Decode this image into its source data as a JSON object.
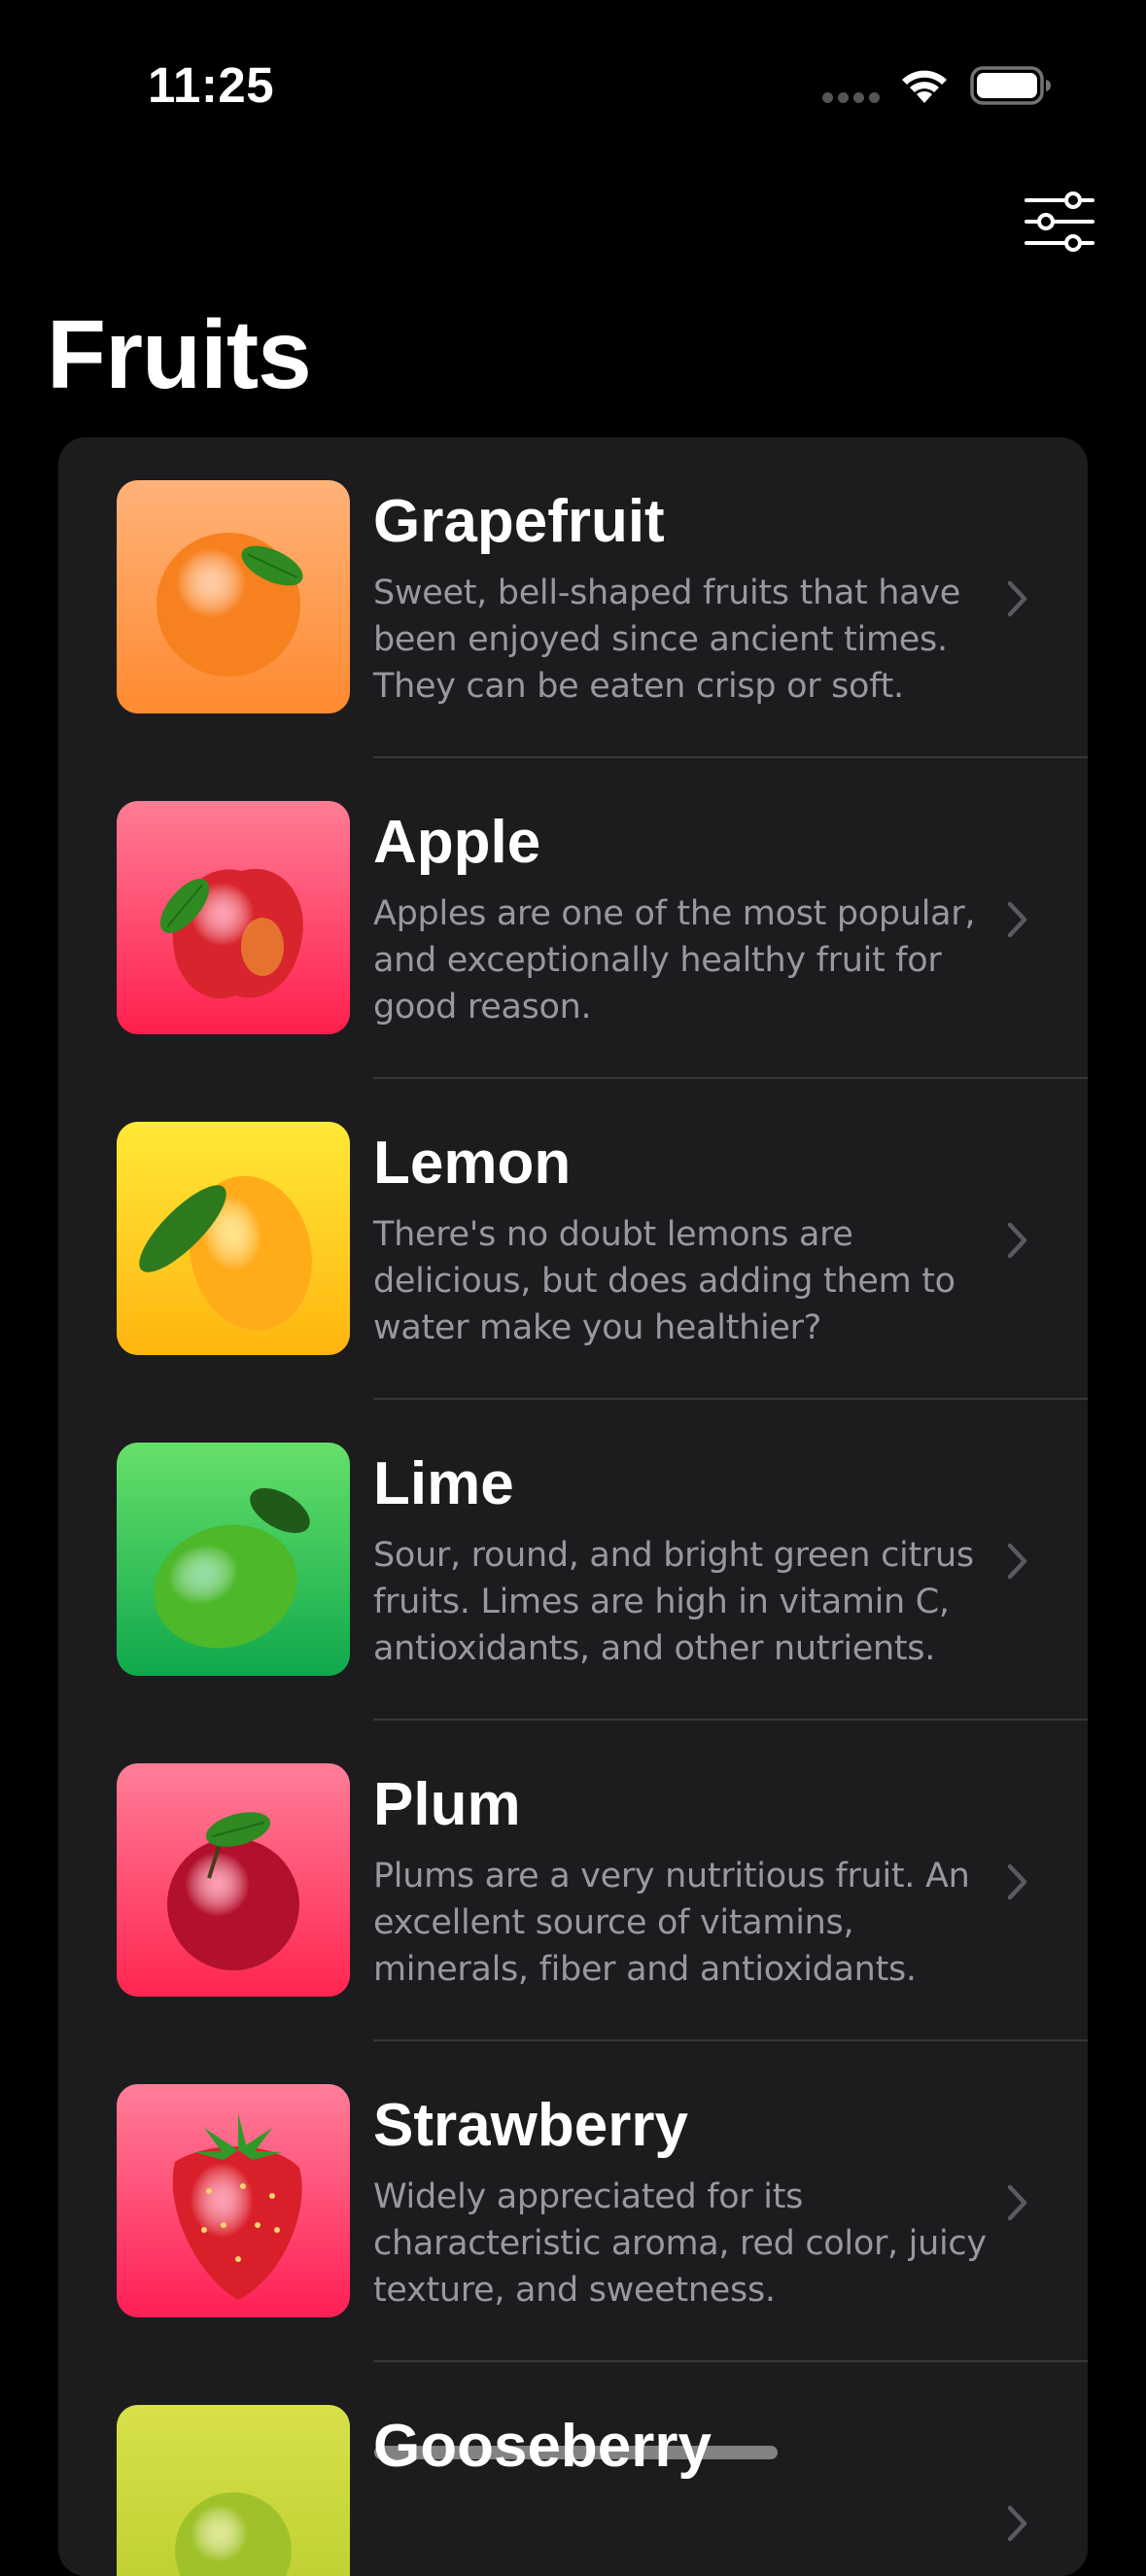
{
  "status_bar": {
    "time": "11:25"
  },
  "navbar": {
    "title": "Fruits",
    "filter_icon": "sliders-icon"
  },
  "fruits": [
    {
      "name": "Grapefruit",
      "description": "Sweet, bell-shaped fruits that have been enjoyed since ancient times. They can be eaten crisp or soft.",
      "gradient": [
        "#ffb27a",
        "#ff8a30"
      ],
      "fruit_color": "#f7801f",
      "icon": "grapefruit-image"
    },
    {
      "name": "Apple",
      "description": "Apples are one of the most popular, and exceptionally healthy fruit for good reason.",
      "gradient": [
        "#ff7c95",
        "#ff1f4e"
      ],
      "fruit_color": "#d8242c",
      "icon": "apple-image"
    },
    {
      "name": "Lemon",
      "description": "There's no doubt lemons are delicious, but does adding them to water make you healthier?",
      "gradient": [
        "#ffe936",
        "#ffb510"
      ],
      "fruit_color": "#ffab1a",
      "icon": "lemon-image"
    },
    {
      "name": "Lime",
      "description": "Sour, round, and bright green citrus fruits. Limes are high in vitamin C, antioxidants, and other nutrients.",
      "gradient": [
        "#66e06a",
        "#10a84c"
      ],
      "fruit_color": "#4cb82a",
      "icon": "lime-image"
    },
    {
      "name": "Plum",
      "description": "Plums are a very nutritious fruit. An excellent source of vitamins, minerals, fiber and antioxidants.",
      "gradient": [
        "#ff7e99",
        "#ff2550"
      ],
      "fruit_color": "#b2112d",
      "icon": "plum-image"
    },
    {
      "name": "Strawberry",
      "description": "Widely appreciated for its characteristic aroma,  red color, juicy texture, and sweetness.",
      "gradient": [
        "#ff7e99",
        "#ff1f55"
      ],
      "fruit_color": "#d9202a",
      "icon": "strawberry-image"
    },
    {
      "name": "Gooseberry",
      "description": "",
      "gradient": [
        "#d8e04a",
        "#b8cc2a"
      ],
      "fruit_color": "#9fc22a",
      "icon": "gooseberry-image"
    }
  ]
}
